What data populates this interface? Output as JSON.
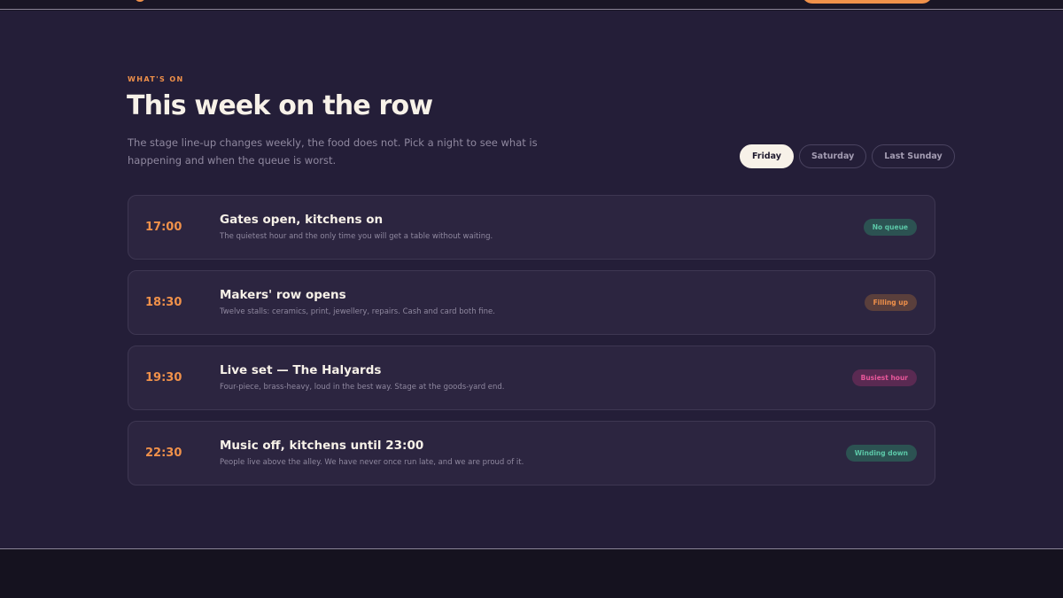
{
  "section": {
    "eyebrow": "What's on",
    "title": "This week on the row",
    "lede": "The stage line-up changes weekly, the food does not. Pick a night to see what is happening and when the queue is worst."
  },
  "tabs": [
    {
      "label": "Friday",
      "active": true
    },
    {
      "label": "Saturday",
      "active": false
    },
    {
      "label": "Last Sunday",
      "active": false
    }
  ],
  "events": [
    {
      "time": "17:00",
      "name": "Gates open, kitchens on",
      "desc": "The quietest hour and the only time you will get a table without waiting.",
      "badge": "No queue",
      "badge_tone": "green"
    },
    {
      "time": "18:30",
      "name": "Makers' row opens",
      "desc": "Twelve stalls: ceramics, print, jewellery, repairs. Cash and card both fine.",
      "badge": "Filling up",
      "badge_tone": "orange"
    },
    {
      "time": "19:30",
      "name": "Live set — The Halyards",
      "desc": "Four-piece, brass-heavy, loud in the best way. Stage at the goods-yard end.",
      "badge": "Busiest hour",
      "badge_tone": "pink"
    },
    {
      "time": "22:30",
      "name": "Music off, kitchens until 23:00",
      "desc": "People live above the alley. We have never once run late, and we are proud of it.",
      "badge": "Winding down",
      "badge_tone": "green"
    }
  ],
  "colors": {
    "accent": "#f0914a",
    "background": "#241e38",
    "card": "#2c2540",
    "badge_green": "#5cc8a8",
    "badge_orange": "#f0914a",
    "badge_pink": "#e8579b"
  }
}
